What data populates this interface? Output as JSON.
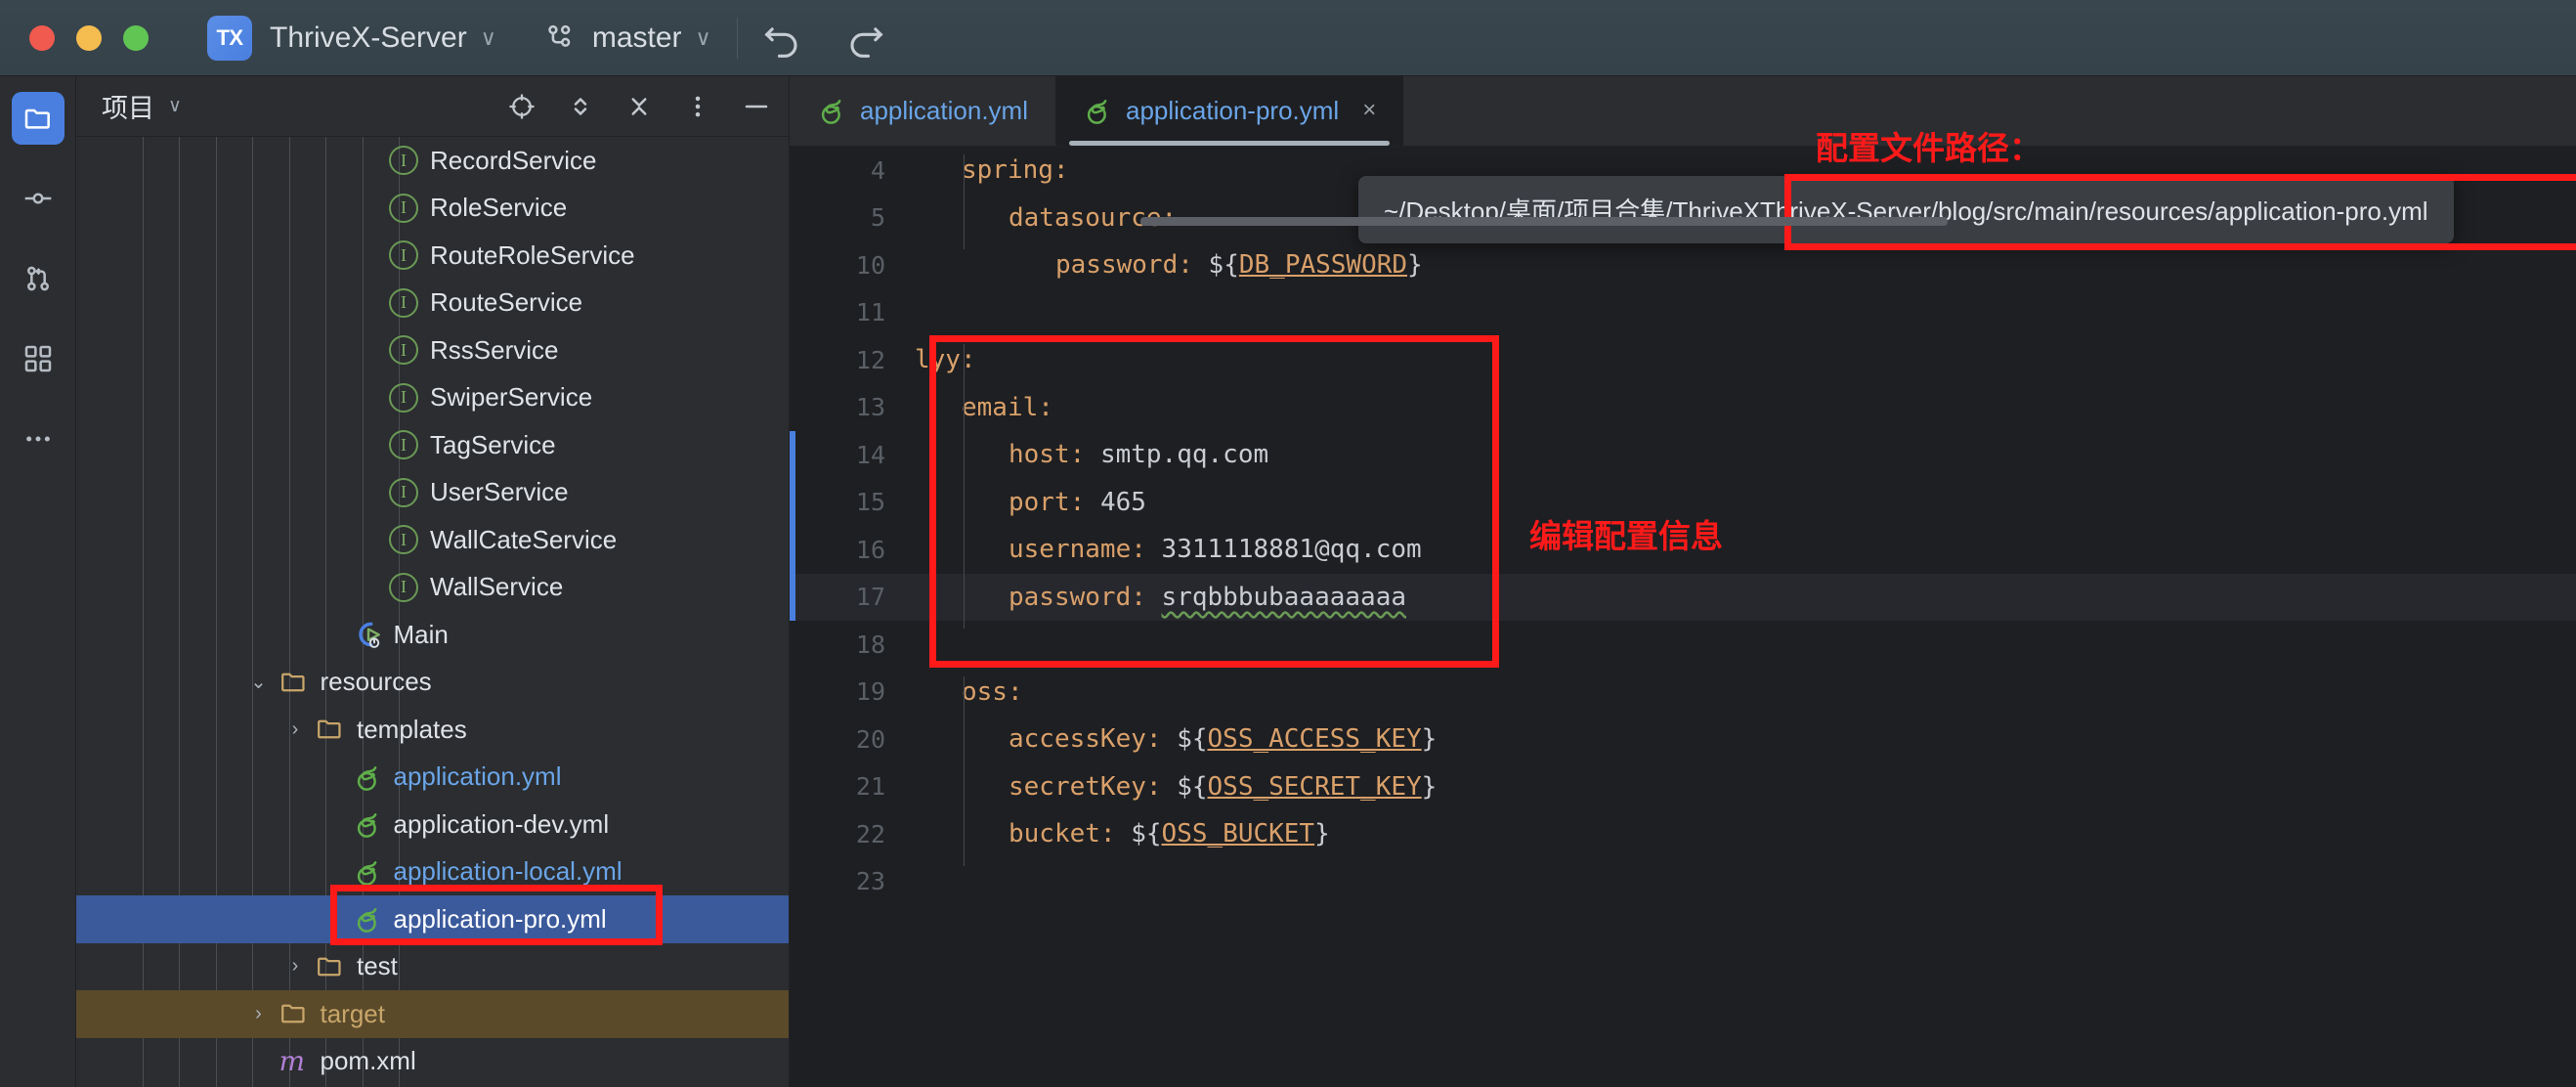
{
  "titlebar": {
    "project_badge": "TX",
    "project_name": "ThriveX-Server",
    "branch": "master",
    "chevron": "∨",
    "icons": {
      "branch": "branch-icon",
      "undo": "undo-icon",
      "redo": "redo-icon"
    }
  },
  "rail": {
    "items": [
      {
        "name": "project-explorer",
        "icon": "folder-icon",
        "active": true
      },
      {
        "name": "commit",
        "icon": "commit-icon",
        "active": false
      },
      {
        "name": "pull-requests",
        "icon": "pull-request-icon",
        "active": false
      },
      {
        "name": "structure",
        "icon": "structure-icon",
        "active": false
      },
      {
        "name": "more-tool-windows",
        "icon": "ellipsis-icon",
        "active": false
      }
    ]
  },
  "panel": {
    "title": "项目",
    "title_chevron": "∨",
    "tools": [
      {
        "name": "select-opened-file",
        "icon": "crosshair-icon"
      },
      {
        "name": "expand-collapse",
        "icon": "chevron-up-down-icon"
      },
      {
        "name": "collapse-all",
        "icon": "collapse-all-icon"
      },
      {
        "name": "options-menu",
        "icon": "vertical-dots-icon"
      },
      {
        "name": "hide-panel",
        "icon": "minus-icon"
      }
    ]
  },
  "tree": {
    "rows": [
      {
        "label": "RecordService",
        "icon": "interface-icon",
        "indent": 8,
        "arrow": "",
        "state": "none",
        "color": "#dfe3e8"
      },
      {
        "label": "RoleService",
        "icon": "interface-icon",
        "indent": 8,
        "arrow": "",
        "state": "none",
        "color": "#dfe3e8"
      },
      {
        "label": "RouteRoleService",
        "icon": "interface-icon",
        "indent": 8,
        "arrow": "",
        "state": "none",
        "color": "#dfe3e8"
      },
      {
        "label": "RouteService",
        "icon": "interface-icon",
        "indent": 8,
        "arrow": "",
        "state": "none",
        "color": "#dfe3e8"
      },
      {
        "label": "RssService",
        "icon": "interface-icon",
        "indent": 8,
        "arrow": "",
        "state": "none",
        "color": "#dfe3e8"
      },
      {
        "label": "SwiperService",
        "icon": "interface-icon",
        "indent": 8,
        "arrow": "",
        "state": "none",
        "color": "#dfe3e8"
      },
      {
        "label": "TagService",
        "icon": "interface-icon",
        "indent": 8,
        "arrow": "",
        "state": "none",
        "color": "#dfe3e8"
      },
      {
        "label": "UserService",
        "icon": "interface-icon",
        "indent": 8,
        "arrow": "",
        "state": "none",
        "color": "#dfe3e8"
      },
      {
        "label": "WallCateService",
        "icon": "interface-icon",
        "indent": 8,
        "arrow": "",
        "state": "none",
        "color": "#dfe3e8"
      },
      {
        "label": "WallService",
        "icon": "interface-icon",
        "indent": 8,
        "arrow": "",
        "state": "none",
        "color": "#dfe3e8"
      },
      {
        "label": "Main",
        "icon": "java-run-class-icon",
        "indent": 7,
        "arrow": "",
        "state": "none",
        "color": "#dfe3e8"
      },
      {
        "label": "resources",
        "icon": "folder-icon",
        "indent": 5,
        "arrow": "⌄",
        "state": "open",
        "color": "#dfe3e8"
      },
      {
        "label": "templates",
        "icon": "folder-icon",
        "indent": 6,
        "arrow": "›",
        "state": "closed",
        "color": "#dfe3e8"
      },
      {
        "label": "application.yml",
        "icon": "spring-yml-icon",
        "indent": 7,
        "arrow": "",
        "state": "none",
        "color": "#6aa5e8"
      },
      {
        "label": "application-dev.yml",
        "icon": "spring-yml-icon",
        "indent": 7,
        "arrow": "",
        "state": "none",
        "color": "#dfe3e8"
      },
      {
        "label": "application-local.yml",
        "icon": "spring-yml-icon",
        "indent": 7,
        "arrow": "",
        "state": "none",
        "color": "#6aa5e8"
      },
      {
        "label": "application-pro.yml",
        "icon": "spring-yml-icon",
        "indent": 7,
        "arrow": "",
        "state": "selected",
        "color": "#ffffff"
      },
      {
        "label": "test",
        "icon": "folder-icon",
        "indent": 6,
        "arrow": "›",
        "state": "closed",
        "color": "#dfe3e8"
      },
      {
        "label": "target",
        "icon": "folder-icon",
        "indent": 5,
        "arrow": "›",
        "state": "excluded",
        "color": "#c8a56a"
      },
      {
        "label": "pom.xml",
        "icon": "maven-icon",
        "indent": 5,
        "arrow": "",
        "state": "none",
        "color": "#dfe3e8"
      }
    ]
  },
  "editor": {
    "tabs": [
      {
        "label": "application.yml",
        "icon": "spring-yml-icon",
        "active": false,
        "closable": false
      },
      {
        "label": "application-pro.yml",
        "icon": "spring-yml-icon",
        "active": true,
        "closable": true,
        "close_glyph": "×"
      }
    ],
    "lines": [
      {
        "num": "4",
        "indent": 1,
        "key": "spring",
        "sep": ":",
        "value": "",
        "highlight": false
      },
      {
        "num": "5",
        "indent": 2,
        "key": "datasource",
        "sep": ":",
        "value": "",
        "highlight": false
      },
      {
        "num": "10",
        "indent": 3,
        "key": "password",
        "sep": ":",
        "value": "${DB_PASSWORD}",
        "highlight": false,
        "var": true
      },
      {
        "num": "11",
        "indent": 0,
        "key": "",
        "sep": "",
        "value": "",
        "highlight": false
      },
      {
        "num": "12",
        "indent": 0,
        "key": "lyy",
        "sep": ":",
        "value": "",
        "highlight": false
      },
      {
        "num": "13",
        "indent": 1,
        "key": "email",
        "sep": ":",
        "value": "",
        "highlight": false
      },
      {
        "num": "14",
        "indent": 2,
        "key": "host",
        "sep": ":",
        "value": "smtp.qq.com",
        "highlight": false
      },
      {
        "num": "15",
        "indent": 2,
        "key": "port",
        "sep": ":",
        "value": "465",
        "highlight": false
      },
      {
        "num": "16",
        "indent": 2,
        "key": "username",
        "sep": ":",
        "value": "3311118881@qq.com",
        "highlight": false
      },
      {
        "num": "17",
        "indent": 2,
        "key": "password",
        "sep": ":",
        "value": "srqbbbubaaaaaaaa",
        "highlight": true,
        "squiggle": true
      },
      {
        "num": "18",
        "indent": 0,
        "key": "",
        "sep": "",
        "value": "",
        "highlight": false
      },
      {
        "num": "19",
        "indent": 1,
        "key": "oss",
        "sep": ":",
        "value": "",
        "highlight": false
      },
      {
        "num": "20",
        "indent": 2,
        "key": "accessKey",
        "sep": ":",
        "value": "${OSS_ACCESS_KEY}",
        "highlight": false,
        "var": true
      },
      {
        "num": "21",
        "indent": 2,
        "key": "secretKey",
        "sep": ":",
        "value": "${OSS_SECRET_KEY}",
        "highlight": false,
        "var": true
      },
      {
        "num": "22",
        "indent": 2,
        "key": "bucket",
        "sep": ":",
        "value": "${OSS_BUCKET}",
        "highlight": false,
        "var": true
      },
      {
        "num": "23",
        "indent": 0,
        "key": "",
        "sep": "",
        "value": "",
        "highlight": false
      }
    ]
  },
  "annotations": {
    "path_label": "配置文件路径：",
    "edit_label": "编辑配置信息",
    "tooltip_prefix": "~/Desktop/桌面/项目合集/ThriveX",
    "tooltip_path": "ThriveX-Server/blog/src/main/resources/application-pro.yml",
    "accent_red": "#ff1a1a"
  }
}
